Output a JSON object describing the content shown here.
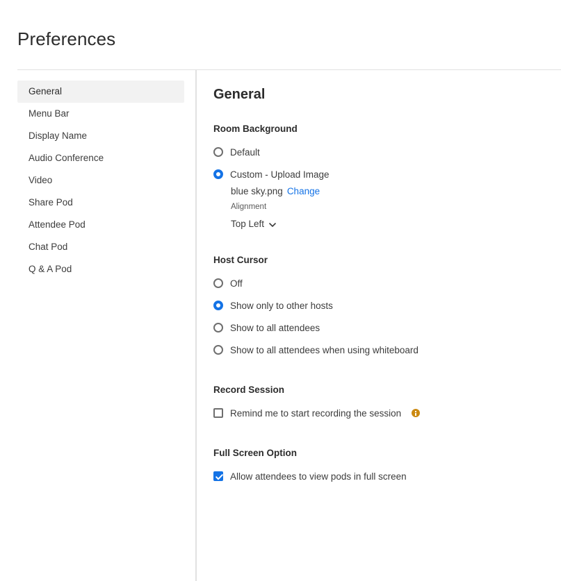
{
  "page": {
    "title": "Preferences"
  },
  "sidebar": {
    "items": [
      {
        "label": "General",
        "selected": true
      },
      {
        "label": "Menu Bar",
        "selected": false
      },
      {
        "label": "Display Name",
        "selected": false
      },
      {
        "label": "Audio Conference",
        "selected": false
      },
      {
        "label": "Video",
        "selected": false
      },
      {
        "label": "Share Pod",
        "selected": false
      },
      {
        "label": "Attendee Pod",
        "selected": false
      },
      {
        "label": "Chat Pod",
        "selected": false
      },
      {
        "label": "Q & A Pod",
        "selected": false
      }
    ]
  },
  "main": {
    "title": "General",
    "room_background": {
      "heading": "Room Background",
      "options": [
        {
          "label": "Default",
          "selected": false
        },
        {
          "label": "Custom - Upload Image",
          "selected": true
        }
      ],
      "file_name": "blue sky.png",
      "change_label": "Change",
      "alignment_label": "Alignment",
      "alignment_value": "Top Left"
    },
    "host_cursor": {
      "heading": "Host Cursor",
      "options": [
        {
          "label": "Off",
          "selected": false
        },
        {
          "label": "Show only to other hosts",
          "selected": true
        },
        {
          "label": "Show to all attendees",
          "selected": false
        },
        {
          "label": "Show to all attendees when using whiteboard",
          "selected": false
        }
      ]
    },
    "record_session": {
      "heading": "Record Session",
      "checkbox_label": "Remind me to start recording the session",
      "checked": false
    },
    "full_screen": {
      "heading": "Full Screen Option",
      "checkbox_label": "Allow attendees to view pods in full screen",
      "checked": true
    }
  },
  "colors": {
    "accent": "#1473e6",
    "info": "#cb8a12",
    "selected_bg": "#f2f2f2",
    "divider": "#e1e1e1"
  },
  "icons": {
    "alignment_dropdown": "chevron-down-icon",
    "record_info": "info-icon",
    "full_screen_check": "checkmark-icon"
  }
}
